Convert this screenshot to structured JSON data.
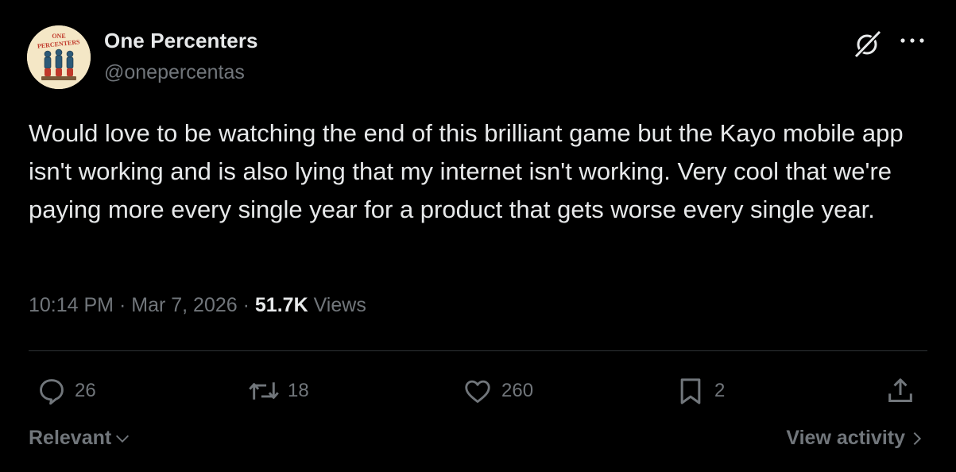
{
  "author": {
    "display_name": "One Percenters",
    "handle": "@onepercentas",
    "avatar_icon": "one-percenters-logo",
    "avatar_text_line1": "ONE",
    "avatar_text_line2": "PERCENTERS"
  },
  "tweet": {
    "text": "Would love to be watching the end of this brilliant game but the Kayo mobile app isn't working and is also lying that my internet isn't working. Very cool that we're paying more every single year for a product that gets worse every single year."
  },
  "meta": {
    "time": "10:14 PM",
    "separator": "·",
    "date": "Mar 7, 2026",
    "views_count": "51.7K",
    "views_label": "Views"
  },
  "actions": {
    "replies": "26",
    "reposts": "18",
    "likes": "260",
    "bookmarks": "2"
  },
  "footer": {
    "sort_label": "Relevant",
    "view_activity_label": "View activity"
  },
  "colors": {
    "background": "#000000",
    "primary_text": "#e7e9ea",
    "secondary_text": "#71767b",
    "divider": "#2f3336",
    "avatar_bg": "#f4e7c6",
    "avatar_accent": "#c0392b"
  }
}
